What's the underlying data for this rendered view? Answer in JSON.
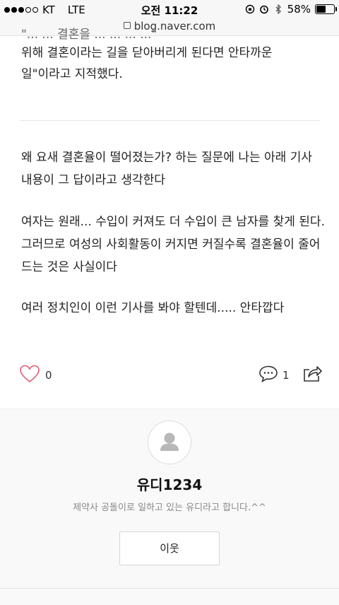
{
  "status_bar": {
    "carrier": "KT",
    "network": "LTE",
    "time": "오전 11:22",
    "battery_percent": "58%",
    "battery_level": 0.58,
    "icons": [
      "signal-icon",
      "orientation-lock-icon",
      "alarm-icon",
      "bluetooth-icon",
      "battery-icon"
    ]
  },
  "browser": {
    "url": "blog.naver.com"
  },
  "article": {
    "cut_line": "\"... ... 결혼을 ... ... ... ...\"",
    "line_top_1": "위해 결혼이라는 길을 닫아버리게 된다면 안타까운",
    "line_top_2": "일\"이라고 지적했다.",
    "paragraph_1": "왜 요새 결혼율이 떨어졌는가? 하는 질문에 나는 아래 기사 내용이 그 답이라고 생각한다",
    "paragraph_2": "여자는 원래... 수입이 커져도 더 수입이 큰 남자를 찾게 된다. 그러므로 여성의 사회활동이 커지면 커질수록 결혼율이 줄어드는 것은 사실이다",
    "paragraph_3": "여러 정치인이 이런 기사를 봐야 할텐데..... 안타깝다"
  },
  "reactions": {
    "like_count": "0",
    "comment_count": "1"
  },
  "profile": {
    "nickname": "유디1234",
    "intro": "제약사 공돌이로 일하고 있는 유디라고 합니다.^^",
    "neighbor_button": "이웃"
  },
  "colors": {
    "like_heart": "#e05a72",
    "text": "#222222",
    "muted": "#888888"
  }
}
